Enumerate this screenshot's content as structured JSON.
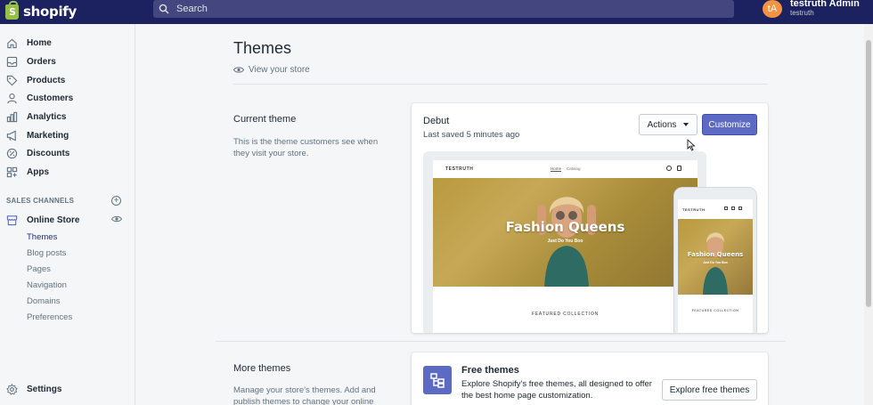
{
  "topbar": {
    "logo_text": "shopify",
    "logo_mark": "S",
    "search_placeholder": "Search",
    "user_initials": "tA",
    "user_name": "testruth Admin",
    "store_name": "testruth"
  },
  "sidebar": {
    "items": [
      {
        "label": "Home",
        "icon": "home-icon"
      },
      {
        "label": "Orders",
        "icon": "orders-icon"
      },
      {
        "label": "Products",
        "icon": "tag-icon"
      },
      {
        "label": "Customers",
        "icon": "person-icon"
      },
      {
        "label": "Analytics",
        "icon": "bar-chart-icon"
      },
      {
        "label": "Marketing",
        "icon": "megaphone-icon"
      },
      {
        "label": "Discounts",
        "icon": "discount-icon"
      },
      {
        "label": "Apps",
        "icon": "apps-icon"
      }
    ],
    "sales_channels_label": "SALES CHANNELS",
    "online_store_label": "Online Store",
    "sub_items": [
      "Themes",
      "Blog posts",
      "Pages",
      "Navigation",
      "Domains",
      "Preferences"
    ],
    "active_sub_item": "Themes",
    "settings_label": "Settings"
  },
  "main": {
    "page_title": "Themes",
    "view_store": "View your store",
    "current_theme": {
      "heading": "Current theme",
      "description": "This is the theme customers see when they visit your store.",
      "theme_name": "Debut",
      "last_saved": "Last saved 5 minutes ago",
      "actions_label": "Actions",
      "customize_label": "Customize"
    },
    "preview": {
      "brand": "TESTRUTH",
      "nav_home": "Home",
      "nav_catalog": "Catalog",
      "hero_title": "Fashion Queens",
      "hero_subtitle": "Just Do You Boo",
      "featured": "FEATURED COLLECTION"
    },
    "more_themes": {
      "heading": "More themes",
      "description": "Manage your store's themes. Add and publish themes to change your online",
      "free_title": "Free themes",
      "free_desc": "Explore Shopify's free themes, all designed to offer the best home page customization.",
      "explore_label": "Explore free themes"
    }
  },
  "colors": {
    "topbar": "#1c2260",
    "accent": "#5c6ac4",
    "avatar": "#f49342"
  }
}
